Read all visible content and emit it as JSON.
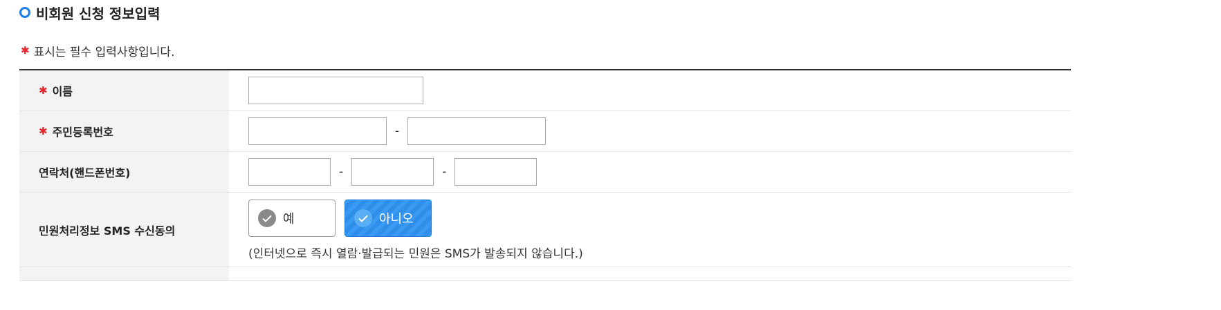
{
  "section": {
    "title": "비회원 신청 정보입력"
  },
  "required_note": {
    "star": "✱",
    "text": "표시는 필수 입력사항입니다."
  },
  "form": {
    "name": {
      "star": "✱",
      "label": "이름",
      "value": ""
    },
    "resident_number": {
      "star": "✱",
      "label": "주민등록번호",
      "part1": "",
      "part2": "",
      "separator": "-"
    },
    "phone": {
      "label": "연락처(핸드폰번호)",
      "part1": "",
      "part2": "",
      "part3": "",
      "separator": "-"
    },
    "sms_consent": {
      "label": "민원처리정보 SMS 수신동의",
      "options": [
        {
          "label": "예",
          "selected": false
        },
        {
          "label": "아니오",
          "selected": true
        }
      ],
      "note": "(인터넷으로 즉시 열람·발급되는 민원은 SMS가 발송되지 않습니다.)"
    }
  },
  "colors": {
    "accent": "#1a7ee6",
    "required": "#e8242c",
    "selected_bg": "#3a99f2"
  },
  "icons": {
    "section": "ring-icon",
    "option": "check-icon"
  }
}
